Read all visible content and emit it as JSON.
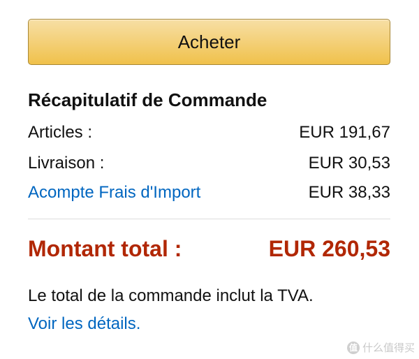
{
  "buy_button": {
    "label": "Acheter"
  },
  "order_summary": {
    "title": "Récapitulatif de Commande",
    "rows": [
      {
        "label": "Articles :",
        "amount": "EUR 191,67",
        "is_link": false
      },
      {
        "label": "Livraison :",
        "amount": "EUR 30,53",
        "is_link": false
      },
      {
        "label": "Acompte Frais d'Import",
        "amount": "EUR 38,33",
        "is_link": true
      }
    ],
    "total_label": "Montant total :",
    "total_amount": "EUR 260,53",
    "vat_note": "Le total de la commande inclut la TVA.",
    "details_link": "Voir les détails."
  },
  "watermark": {
    "icon": "zhi-logo-icon",
    "text": "什么值得买"
  },
  "colors": {
    "button_top": "#f7dfa5",
    "button_bottom": "#f0c14b",
    "button_border": "#a88734",
    "link": "#0066c0",
    "total": "#b12704",
    "divider": "#dddddd"
  }
}
